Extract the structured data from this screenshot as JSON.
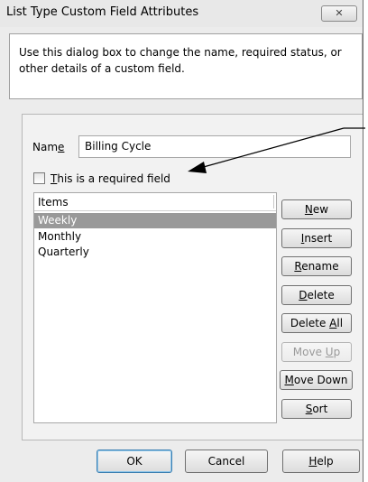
{
  "window": {
    "title": "List Type Custom Field Attributes",
    "close_icon": "close-icon"
  },
  "description": "Use this dialog box to change the name, required status, or other details of a custom field.",
  "name_field": {
    "label_pre": "Nam",
    "label_u": "e",
    "value": "Billing Cycle"
  },
  "required_checkbox": {
    "label_u": "T",
    "label_rest": "his is a required field",
    "checked": false
  },
  "items_list": {
    "header": "Items",
    "items": [
      "Weekly",
      "Monthly",
      "Quarterly"
    ],
    "selected": "Weekly"
  },
  "buttons": {
    "new": {
      "u": "N",
      "rest": "ew"
    },
    "insert": {
      "u": "I",
      "rest": "nsert"
    },
    "rename": {
      "u": "R",
      "rest": "ename"
    },
    "delete": {
      "u": "D",
      "rest": "elete"
    },
    "delete_all": {
      "pre": "Delete ",
      "u": "A",
      "rest": "ll"
    },
    "move_up": {
      "pre": "Move ",
      "u": "U",
      "rest": "p"
    },
    "move_down": {
      "u": "M",
      "rest": "ove Down"
    },
    "sort": {
      "u": "S",
      "rest": "ort"
    }
  },
  "footer": {
    "ok": "OK",
    "cancel": "Cancel",
    "help_u": "H",
    "help_rest": "elp"
  },
  "colors": {
    "selection": "#999999",
    "dialog_bg": "#ececec"
  }
}
